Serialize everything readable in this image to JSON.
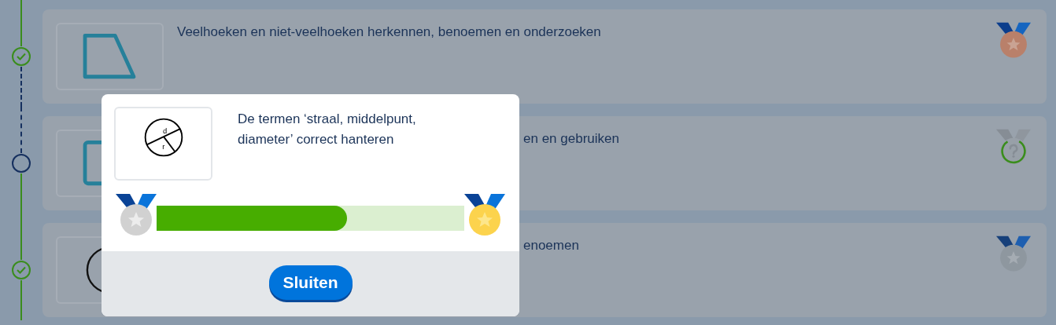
{
  "lessons": [
    {
      "node": {
        "kind": "done"
      },
      "thumbnail": {
        "kind": "trapezoid"
      },
      "title": "Veelhoeken en niet-veelhoeken herkennen, benoemen en onderzoeken",
      "covered": false,
      "medal": {
        "kind": "bronze"
      }
    },
    {
      "node": {
        "kind": "current"
      },
      "thumbnail": {
        "kind": "square"
      },
      "title": "en en gebruiken",
      "covered": true,
      "medal": {
        "kind": "in-progress"
      }
    },
    {
      "node": {
        "kind": "done"
      },
      "thumbnail": {
        "kind": "circle"
      },
      "title": "enoemen",
      "covered": true,
      "medal": {
        "kind": "locked"
      }
    }
  ],
  "dialog": {
    "diagram_labels": [
      "d",
      "r"
    ],
    "description": "De termen ‘straal, middelpunt, diameter’ correct hanteren",
    "progress": {
      "level": 0.62,
      "start_medal": {
        "kind": "silver"
      },
      "end_medal": {
        "kind": "gold"
      }
    },
    "close_button": "Sluiten"
  }
}
